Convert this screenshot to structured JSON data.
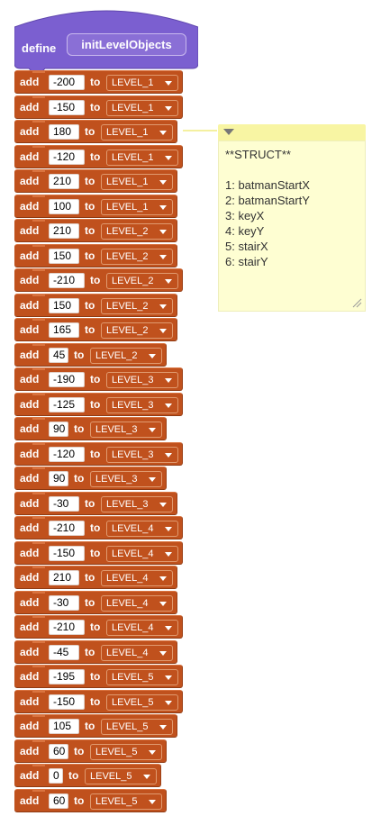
{
  "define_block": {
    "label": "define",
    "procedure_name": "initLevelObjects",
    "color": "#7b5fd0"
  },
  "block_color": "#c0511d",
  "add_label": "add",
  "to_label": "to",
  "blocks": [
    {
      "value": "-200",
      "list": "LEVEL_1"
    },
    {
      "value": "-150",
      "list": "LEVEL_1"
    },
    {
      "value": "180",
      "list": "LEVEL_1"
    },
    {
      "value": "-120",
      "list": "LEVEL_1"
    },
    {
      "value": "210",
      "list": "LEVEL_1"
    },
    {
      "value": "100",
      "list": "LEVEL_1"
    },
    {
      "value": "210",
      "list": "LEVEL_2"
    },
    {
      "value": "150",
      "list": "LEVEL_2"
    },
    {
      "value": "-210",
      "list": "LEVEL_2"
    },
    {
      "value": "150",
      "list": "LEVEL_2"
    },
    {
      "value": "165",
      "list": "LEVEL_2"
    },
    {
      "value": "45",
      "list": "LEVEL_2"
    },
    {
      "value": "-190",
      "list": "LEVEL_3"
    },
    {
      "value": "-125",
      "list": "LEVEL_3"
    },
    {
      "value": "90",
      "list": "LEVEL_3"
    },
    {
      "value": "-120",
      "list": "LEVEL_3"
    },
    {
      "value": "90",
      "list": "LEVEL_3"
    },
    {
      "value": "-30",
      "list": "LEVEL_3"
    },
    {
      "value": "-210",
      "list": "LEVEL_4"
    },
    {
      "value": "-150",
      "list": "LEVEL_4"
    },
    {
      "value": "210",
      "list": "LEVEL_4"
    },
    {
      "value": "-30",
      "list": "LEVEL_4"
    },
    {
      "value": "-210",
      "list": "LEVEL_4"
    },
    {
      "value": "-45",
      "list": "LEVEL_4"
    },
    {
      "value": "-195",
      "list": "LEVEL_5"
    },
    {
      "value": "-150",
      "list": "LEVEL_5"
    },
    {
      "value": "105",
      "list": "LEVEL_5"
    },
    {
      "value": "60",
      "list": "LEVEL_5"
    },
    {
      "value": "0",
      "list": "LEVEL_5"
    },
    {
      "value": "60",
      "list": "LEVEL_5"
    }
  ],
  "comment": {
    "text": "**STRUCT**\n\n1: batmanStartX\n2: batmanStartY\n3: keyX\n4: keyY\n5: stairX\n6: stairY",
    "color": "#fefed2"
  },
  "icons": {
    "dropdown": "dropdown-arrow-icon",
    "collapse": "collapse-triangle-icon",
    "resize": "resize-grip-icon"
  }
}
